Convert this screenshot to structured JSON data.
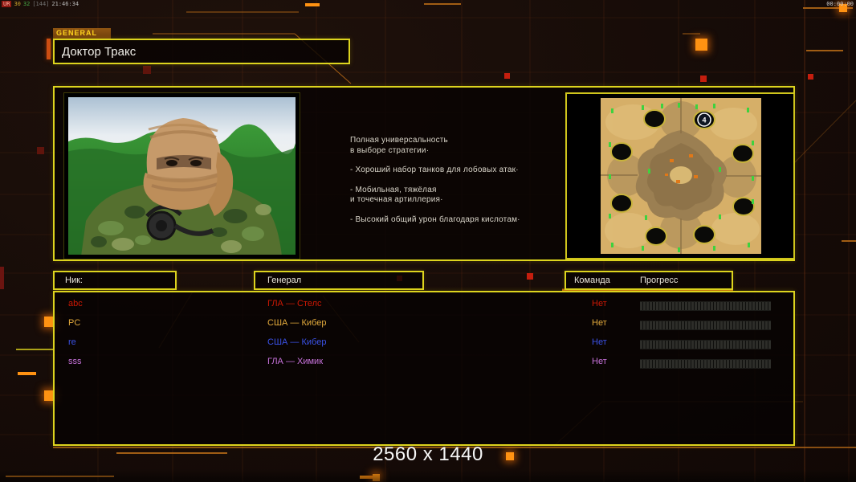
{
  "overlay": {
    "stats": [
      {
        "text": "UR",
        "color": "#ffb0a0",
        "bg": "#8e1812"
      },
      {
        "text": "30",
        "color": "#c8a22c",
        "bg": ""
      },
      {
        "text": "32",
        "color": "#46a846",
        "bg": ""
      },
      {
        "text": "[144]",
        "color": "#757575",
        "bg": ""
      },
      {
        "text": "21:46:34",
        "color": "#b9b9b9",
        "bg": ""
      }
    ],
    "clock": "00:00:00"
  },
  "general_panel": {
    "tag_label": "GENERAL",
    "name": "Доктор Тракс",
    "description_paragraphs": [
      [
        "Полная универсальность",
        "в выборе стратегии·"
      ],
      [
        "- Хороший набор танков для лобовых атак·"
      ],
      [
        "- Мобильная, тяжёлая",
        "и точечная артиллерия·"
      ],
      [
        "- Высокий общий урон благодаря кислотам·"
      ]
    ],
    "map": {
      "player_slot_badge": "4"
    }
  },
  "lobby": {
    "headers": {
      "nick": "Ник:",
      "general": "Генерал",
      "team": "Команда",
      "progress": "Прогресс"
    },
    "players": [
      {
        "nick": "abc",
        "general": "ГЛА — Стелс",
        "team": "Нет",
        "color": "#cc1804"
      },
      {
        "nick": "PC",
        "general": "США — Кибер",
        "team": "Нет",
        "color": "#e2aa3c"
      },
      {
        "nick": "re",
        "general": "США — Кибер",
        "team": "Нет",
        "color": "#3b52e8"
      },
      {
        "nick": "sss",
        "general": "ГЛА — Химик",
        "team": "Нет",
        "color": "#c873dc"
      }
    ]
  },
  "footer": {
    "resolution": "2560 x 1440"
  },
  "colors": {
    "accent_yellow": "#ddd41e",
    "accent_orange": "#ff9212",
    "line_orange": "#b06616",
    "background": "#170c08"
  }
}
